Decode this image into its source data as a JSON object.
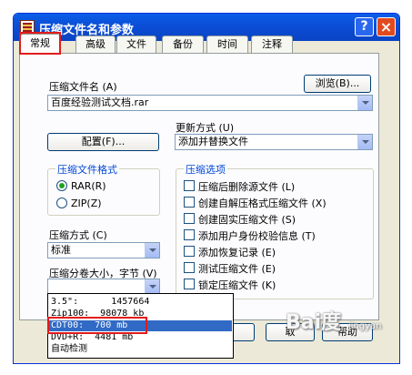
{
  "window": {
    "title": "压缩文件名和参数",
    "help_label": "?",
    "close_label": "×"
  },
  "tabs": [
    {
      "label": "常规",
      "active": true
    },
    {
      "label": "高级"
    },
    {
      "label": "文件"
    },
    {
      "label": "备份"
    },
    {
      "label": "时间"
    },
    {
      "label": "注释"
    }
  ],
  "archive": {
    "label": "压缩文件名 (A)",
    "value": "百度经验测试文档.rar",
    "browse_label": "浏览(B)..."
  },
  "update": {
    "label": "更新方式 (U)",
    "value": "添加并替换文件"
  },
  "profiles_label": "配置(F)...",
  "format": {
    "title": "压缩文件格式",
    "options": [
      {
        "label": "RAR(R)",
        "checked": true
      },
      {
        "label": "ZIP(Z)",
        "checked": false
      }
    ]
  },
  "method": {
    "label": "压缩方式 (C)",
    "value": "标准"
  },
  "volume": {
    "label": "压缩分卷大小，字节 (V)",
    "value": "",
    "options": [
      "3.5\":      1457664",
      "Zip100:  98078 kb",
      "CDT00:  700 mb",
      "DVD+R:  4481 mb",
      "自动检测"
    ],
    "selected_index": 2
  },
  "options": {
    "title": "压缩选项",
    "items": [
      {
        "label": "压缩后删除源文件 (L)",
        "checked": false
      },
      {
        "label": "创建自解压格式压缩文件 (X)",
        "checked": false
      },
      {
        "label": "创建固实压缩文件 (S)",
        "checked": false
      },
      {
        "label": "添加用户身份校验信息 (T)",
        "checked": false
      },
      {
        "label": "添加恢复记录 (E)",
        "checked": false
      },
      {
        "label": "测试压缩文件 (E)",
        "checked": false
      },
      {
        "label": "锁定压缩文件 (K)",
        "checked": false
      }
    ]
  },
  "footer": {
    "cancel_label": "取",
    "help_label": "帮助"
  },
  "watermark": {
    "text": "Bai度",
    "sub": "jingyan"
  },
  "colors": {
    "titlebar": "#0b4ed6",
    "highlight": "#e31b1b",
    "selection": "#316ac5",
    "group_title": "#0046d5"
  }
}
